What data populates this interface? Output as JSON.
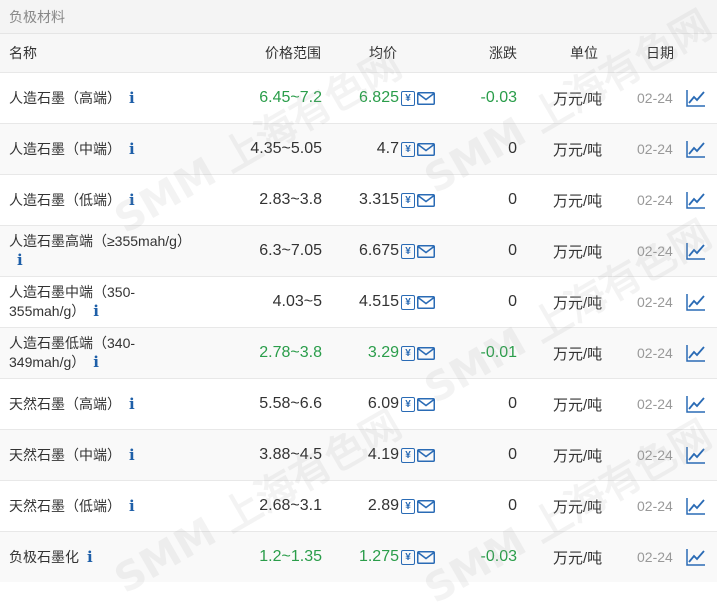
{
  "title": "负极材料",
  "columns": {
    "name": "名称",
    "range": "价格范围",
    "avg": "均价",
    "change": "涨跌",
    "unit": "单位",
    "date": "日期"
  },
  "info_symbol": "i",
  "yen_symbol": "¥",
  "watermark": "SMM 上海有色网",
  "rows": [
    {
      "name": "人造石墨（高端）",
      "range": "6.45~7.2",
      "avg": "6.825",
      "change": "-0.03",
      "unit": "万元/吨",
      "date": "02-24",
      "trend": "down"
    },
    {
      "name": "人造石墨（中端）",
      "range": "4.35~5.05",
      "avg": "4.7",
      "change": "0",
      "unit": "万元/吨",
      "date": "02-24",
      "trend": "flat"
    },
    {
      "name": "人造石墨（低端）",
      "range": "2.83~3.8",
      "avg": "3.315",
      "change": "0",
      "unit": "万元/吨",
      "date": "02-24",
      "trend": "flat"
    },
    {
      "name": "人造石墨高端（≥355mah/g）",
      "range": "6.3~7.05",
      "avg": "6.675",
      "change": "0",
      "unit": "万元/吨",
      "date": "02-24",
      "trend": "flat"
    },
    {
      "name": "人造石墨中端（350-355mah/g）",
      "range": "4.03~5",
      "avg": "4.515",
      "change": "0",
      "unit": "万元/吨",
      "date": "02-24",
      "trend": "flat"
    },
    {
      "name": "人造石墨低端（340-349mah/g）",
      "range": "2.78~3.8",
      "avg": "3.29",
      "change": "-0.01",
      "unit": "万元/吨",
      "date": "02-24",
      "trend": "down"
    },
    {
      "name": "天然石墨（高端）",
      "range": "5.58~6.6",
      "avg": "6.09",
      "change": "0",
      "unit": "万元/吨",
      "date": "02-24",
      "trend": "flat"
    },
    {
      "name": "天然石墨（中端）",
      "range": "3.88~4.5",
      "avg": "4.19",
      "change": "0",
      "unit": "万元/吨",
      "date": "02-24",
      "trend": "flat"
    },
    {
      "name": "天然石墨（低端）",
      "range": "2.68~3.1",
      "avg": "2.89",
      "change": "0",
      "unit": "万元/吨",
      "date": "02-24",
      "trend": "flat"
    },
    {
      "name": "负极石墨化",
      "range": "1.2~1.35",
      "avg": "1.275",
      "change": "-0.03",
      "unit": "万元/吨",
      "date": "02-24",
      "trend": "down"
    }
  ],
  "colors": {
    "down": "#2a9d4a",
    "neutral": "#333333",
    "icon": "#2a6bb5"
  }
}
